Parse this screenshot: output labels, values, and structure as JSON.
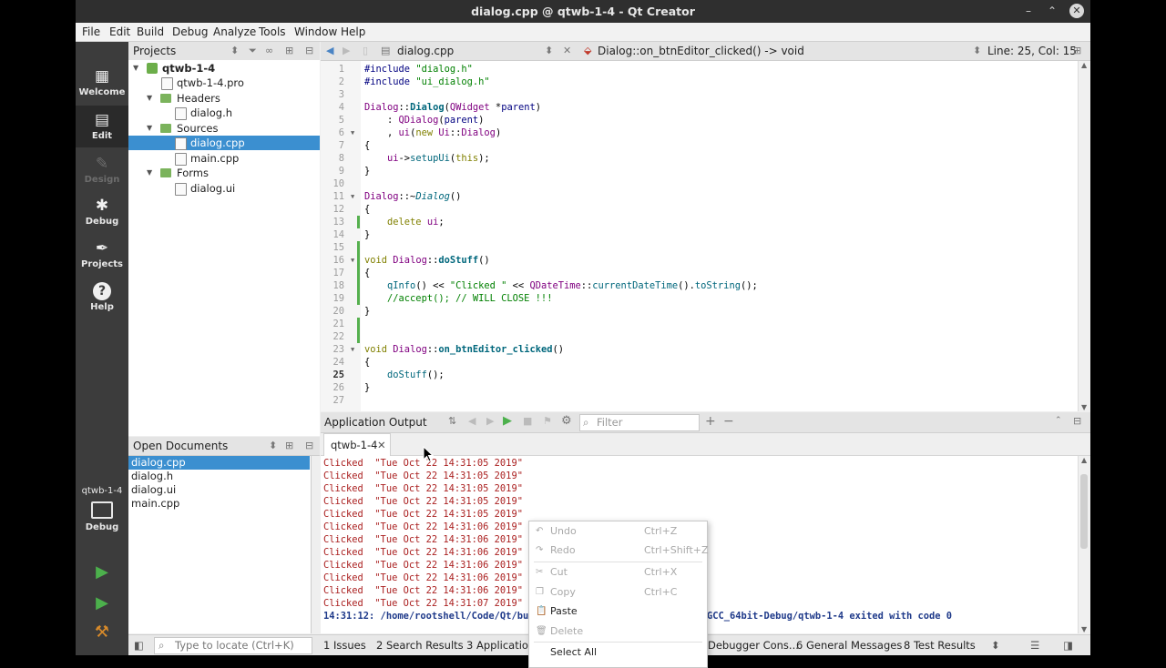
{
  "window": {
    "title": "dialog.cpp @ qtwb-1-4 - Qt Creator"
  },
  "menu": [
    "File",
    "Edit",
    "Build",
    "Debug",
    "Analyze",
    "Tools",
    "Window",
    "Help"
  ],
  "modes": [
    {
      "label": "Welcome",
      "icon": "grid-icon"
    },
    {
      "label": "Edit",
      "icon": "edit-doc-icon"
    },
    {
      "label": "Design",
      "icon": "pencil-icon"
    },
    {
      "label": "Debug",
      "icon": "bug-icon"
    },
    {
      "label": "Projects",
      "icon": "wrench-icon"
    },
    {
      "label": "Help",
      "icon": "help-icon"
    }
  ],
  "kit": {
    "project": "qtwb-1-4",
    "mode": "Debug"
  },
  "projects_panel": {
    "title": "Projects",
    "tree": [
      "qtwb-1-4",
      "qtwb-1-4.pro",
      "Headers",
      "dialog.h",
      "Sources",
      "dialog.cpp",
      "main.cpp",
      "Forms",
      "dialog.ui"
    ]
  },
  "open_documents": {
    "title": "Open Documents",
    "items": [
      "dialog.cpp",
      "dialog.h",
      "dialog.ui",
      "main.cpp"
    ]
  },
  "editor": {
    "file": "dialog.cpp",
    "symbol": "Dialog::on_btnEditor_clicked() -> void",
    "position": "Line: 25, Col: 15",
    "line_numbers": [
      "1",
      "2",
      "3",
      "4",
      "5",
      "6",
      "7",
      "8",
      "9",
      "10",
      "11",
      "12",
      "13",
      "14",
      "15",
      "16",
      "17",
      "18",
      "19",
      "20",
      "21",
      "22",
      "23",
      "24",
      "25",
      "26",
      "27"
    ]
  },
  "output_panel": {
    "title": "Application Output",
    "filter_placeholder": "Filter",
    "tab": "qtwb-1-4",
    "lines": [
      "Clicked  \"Tue Oct 22 14:31:05 2019\"",
      "Clicked  \"Tue Oct 22 14:31:05 2019\"",
      "Clicked  \"Tue Oct 22 14:31:05 2019\"",
      "Clicked  \"Tue Oct 22 14:31:05 2019\"",
      "Clicked  \"Tue Oct 22 14:31:05 2019\"",
      "Clicked  \"Tue Oct 22 14:31:06 2019\"",
      "Clicked  \"Tue Oct 22 14:31:06 2019\"",
      "Clicked  \"Tue Oct 22 14:31:06 2019\"",
      "Clicked  \"Tue Oct 22 14:31:06 2019\"",
      "Clicked  \"Tue Oct 22 14:31:06 2019\"",
      "Clicked  \"Tue Oct 22 14:31:06 2019\"",
      "Clicked  \"Tue Oct 22 14:31:07 2019\""
    ],
    "exit_left": "14:31:12: /home/rootshell/Code/Qt/bu",
    "exit_right": "GCC_64bit-Debug/qtwb-1-4 exited with code 0"
  },
  "context_menu": [
    {
      "label": "Undo",
      "shortcut": "Ctrl+Z",
      "enabled": false,
      "icon": "undo-icon"
    },
    {
      "label": "Redo",
      "shortcut": "Ctrl+Shift+Z",
      "enabled": false,
      "icon": "redo-icon"
    },
    {
      "label": "Cut",
      "shortcut": "Ctrl+X",
      "enabled": false,
      "icon": "cut-icon"
    },
    {
      "label": "Copy",
      "shortcut": "Ctrl+C",
      "enabled": false,
      "icon": "copy-icon"
    },
    {
      "label": "Paste",
      "shortcut": "",
      "enabled": true,
      "icon": "paste-icon"
    },
    {
      "label": "Delete",
      "shortcut": "",
      "enabled": false,
      "icon": "delete-icon"
    },
    {
      "label": "Select All",
      "shortcut": "",
      "enabled": true,
      "icon": ""
    }
  ],
  "statusbar": {
    "locate_placeholder": "Type to locate (Ctrl+K)",
    "panes": [
      "1  Issues",
      "2  Search Results",
      "3  Application",
      "Debugger Cons...",
      "6  General Messages",
      "8  Test Results"
    ]
  },
  "colors": {
    "accent": "#3b8fd0",
    "modebar": "#3c3c3c",
    "output_text": "#aa1f1f",
    "run_green": "#4cb04c"
  }
}
